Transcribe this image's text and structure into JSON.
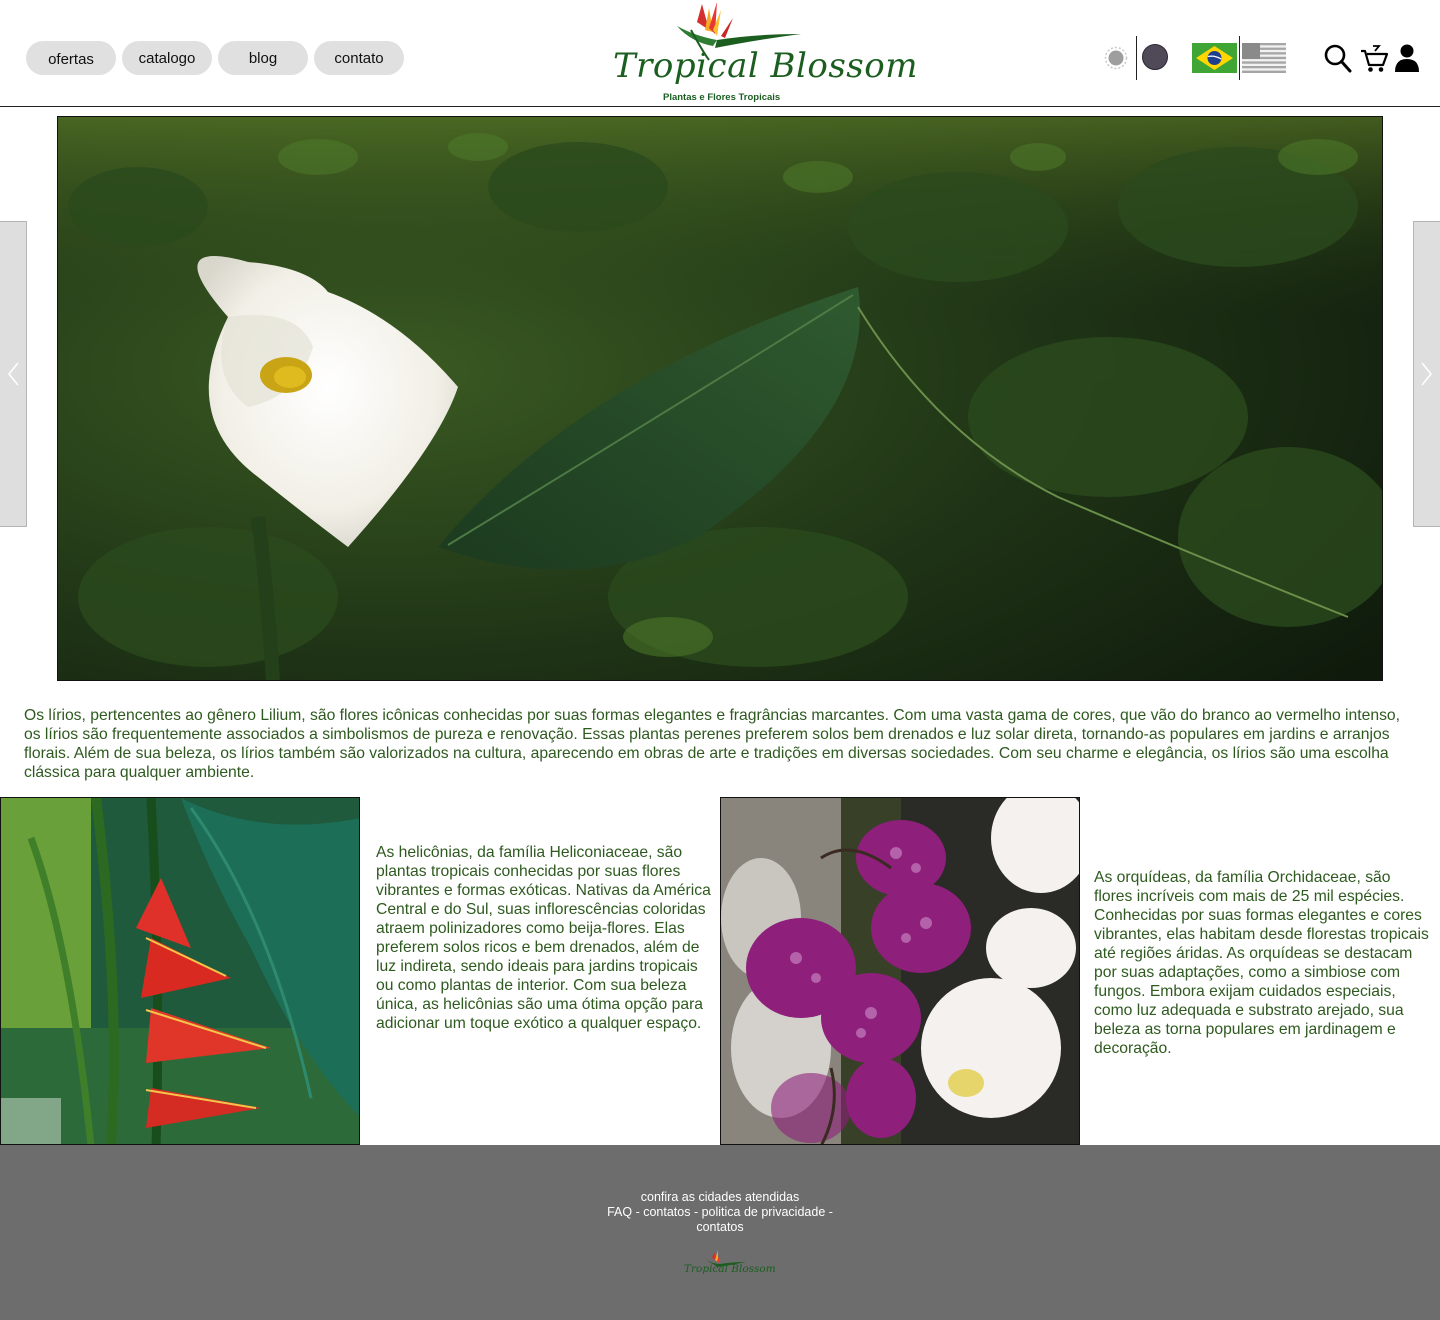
{
  "nav": {
    "items": [
      {
        "label": "ofertas"
      },
      {
        "label": "catalogo"
      },
      {
        "label": "blog"
      },
      {
        "label": "contato"
      }
    ]
  },
  "logo": {
    "title": "Tropical Blossom",
    "subtitle": "Plantas e Flores Tropicais"
  },
  "header_controls": {
    "theme_options": [
      "sun-icon",
      "moon-icon"
    ],
    "languages": [
      "brazil-flag-icon",
      "usa-flag-icon"
    ],
    "icons": [
      "search-icon",
      "cart-icon",
      "user-icon"
    ]
  },
  "hero": {
    "image": "white-calla-lily-photo",
    "prev_icon": "chevron-left-icon",
    "next_icon": "chevron-right-icon"
  },
  "content": {
    "lilies_text": "Os lírios, pertencentes ao gênero Lilium, são flores icônicas conhecidas por suas formas elegantes e fragrâncias marcantes. Com uma vasta gama de cores, que vão do branco ao vermelho intenso, os lírios são frequentemente associados a simbolismos de pureza e renovação. Essas plantas perenes preferem solos bem drenados e luz solar direta, tornando-as populares em jardins e arranjos florais. Além de sua beleza, os lírios também são valorizados na cultura, aparecendo em obras de arte e tradições em diversas sociedades. Com seu charme e elegância, os lírios são uma escolha clássica para qualquer ambiente.",
    "heliconia_text": "As helicônias, da família Heliconiaceae, são plantas tropicais conhecidas por suas flores vibrantes e formas exóticas. Nativas da América Central e do Sul, suas inflorescências coloridas atraem polinizadores como beija-flores. Elas preferem solos ricos e bem drenados, além de luz indireta, sendo ideais para jardins tropicais ou como plantas de interior. Com sua beleza única, as helicônias são uma ótima opção para adicionar um toque exótico a qualquer espaço.",
    "orchid_text": "As orquídeas, da família Orchidaceae, são flores incríveis com mais de 25 mil espécies. Conhecidas por suas formas elegantes e cores vibrantes, elas habitam desde florestas tropicais até regiões áridas. As orquídeas se destacam por suas adaptações, como a simbiose com fungos. Embora exijam cuidados especiais, como luz adequada e substrato arejado, sua beleza as torna populares em jardinagem e decoração."
  },
  "footer": {
    "line1": "confira as cidades atendidas",
    "link_faq": "FAQ",
    "link_contatos": "contatos",
    "link_privacidade": "politica de privacidade",
    "link_contatos2": "contatos",
    "separator": " - ",
    "logo_text": "Tropical Blossom"
  },
  "colors": {
    "text_green": "#2e5a1f",
    "brand_green": "#1b5e20",
    "footer_bg": "#6d6d6d",
    "pill_bg": "#e0e0e0"
  }
}
